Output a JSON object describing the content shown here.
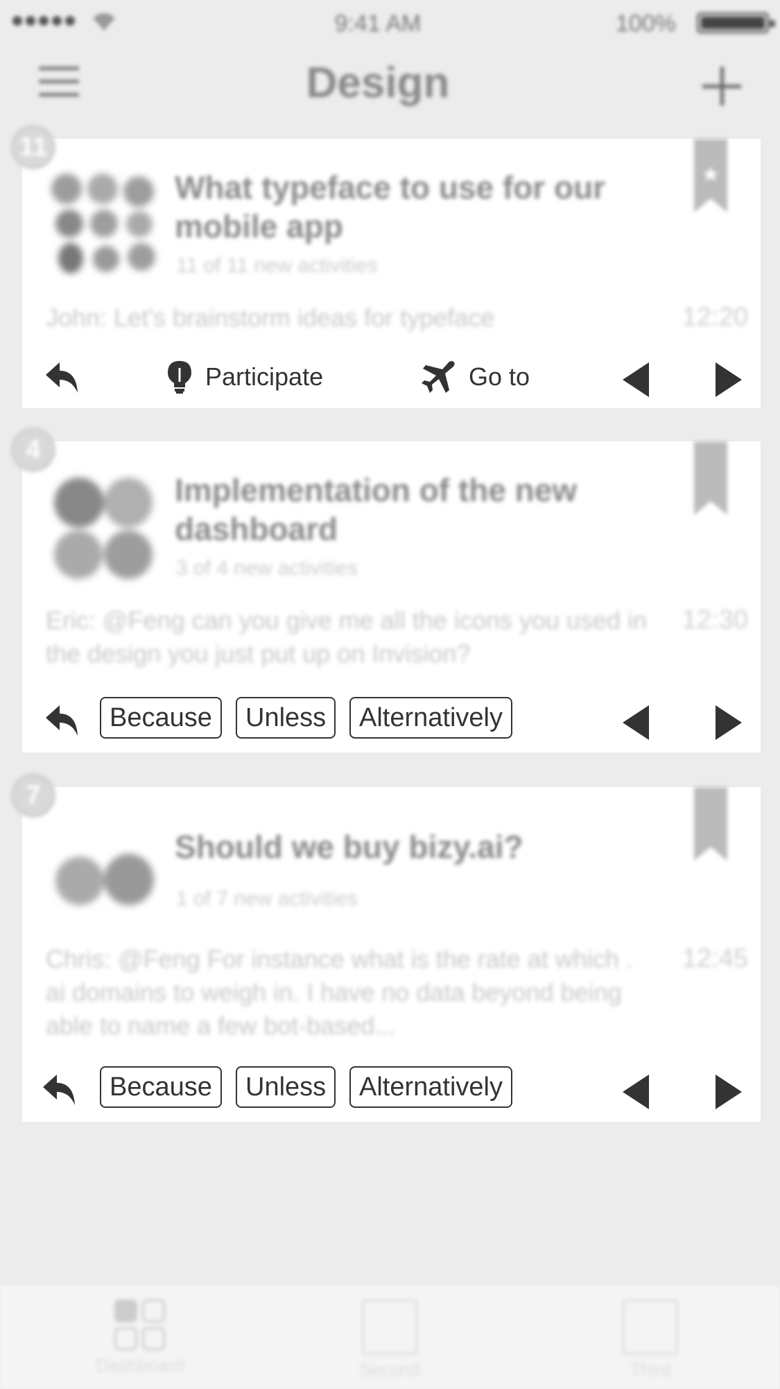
{
  "status_bar": {
    "time": "9:41 AM",
    "battery": "100%"
  },
  "nav": {
    "title": "Design"
  },
  "cards": [
    {
      "badge": "11",
      "title": "What typeface to use for our mobile app",
      "subtitle": "11 of 11 new activities",
      "preview": "John: Let's brainstorm ideas for typeface",
      "time": "12:20",
      "actions": {
        "participate": "Participate",
        "goto": "Go to"
      },
      "bookmarked": true
    },
    {
      "badge": "4",
      "title": "Implementation of the new dashboard",
      "subtitle": "3 of 4 new activities",
      "preview": "Eric: @Feng can you give me all the icons you used in the design you just put up on Invision?",
      "time": "12:30",
      "chips": [
        "Because",
        "Unless",
        "Alternatively"
      ],
      "bookmarked": false
    },
    {
      "badge": "7",
      "title": "Should we buy bizy.ai?",
      "subtitle": "1 of 7 new activities",
      "preview": "Chris: @Feng For instance what is the rate at which . ai domains to weigh in. I have no data beyond being able to name a few bot-based...",
      "time": "12:45",
      "chips": [
        "Because",
        "Unless",
        "Alternatively"
      ],
      "bookmarked": false
    }
  ],
  "tab_bar": {
    "tabs": [
      {
        "label": "Dashboard"
      },
      {
        "label": "Second"
      },
      {
        "label": "Third"
      }
    ]
  },
  "colors": {
    "background": "#ececec",
    "card": "#ffffff",
    "text_dark": "#333333",
    "muted": "#8a8a8a"
  }
}
